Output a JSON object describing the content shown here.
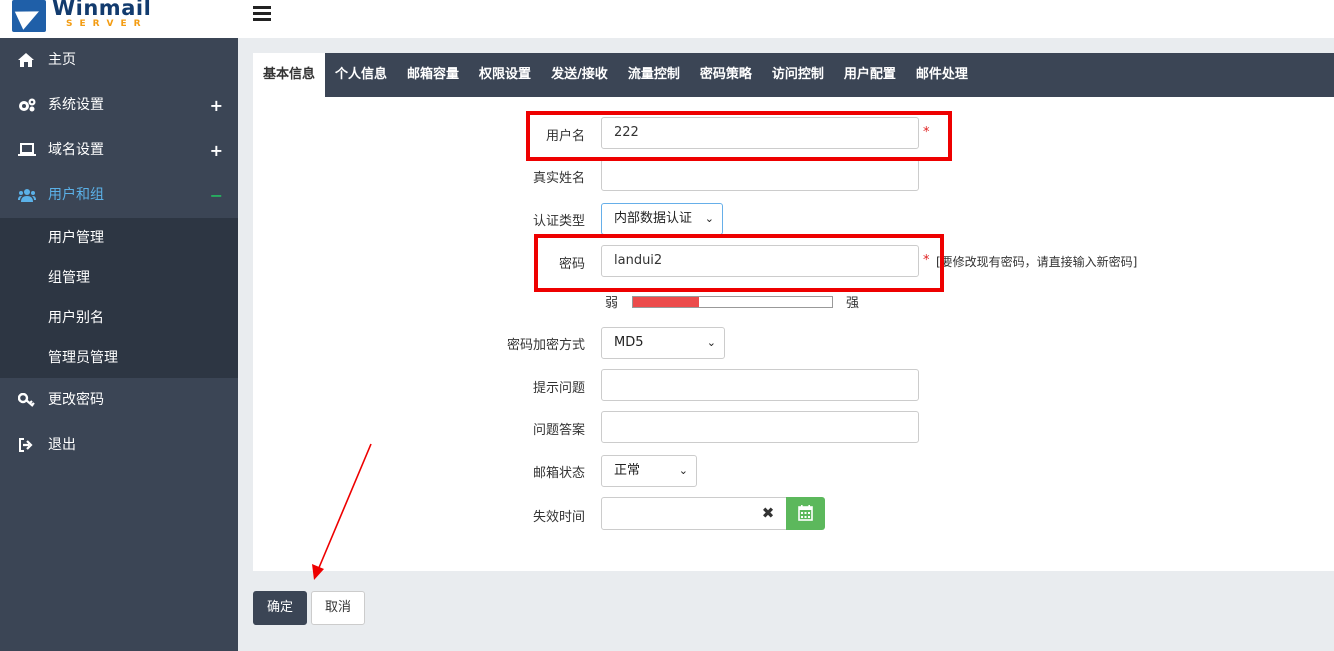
{
  "app": {
    "logo_name": "Winmail",
    "logo_sub": "SERVER"
  },
  "sidebar": {
    "items": [
      {
        "label": "主页",
        "icon": "home-icon",
        "toggle": ""
      },
      {
        "label": "系统设置",
        "icon": "gears-icon",
        "toggle": "+"
      },
      {
        "label": "域名设置",
        "icon": "laptop-icon",
        "toggle": "+"
      },
      {
        "label": "用户和组",
        "icon": "users-icon",
        "toggle": "−"
      },
      {
        "label": "更改密码",
        "icon": "key-icon",
        "toggle": ""
      },
      {
        "label": "退出",
        "icon": "sign-out-icon",
        "toggle": ""
      }
    ],
    "submenu": [
      "用户管理",
      "组管理",
      "用户别名",
      "管理员管理"
    ],
    "active_color": "#5bb1e8"
  },
  "tabs": [
    "基本信息",
    "个人信息",
    "邮箱容量",
    "权限设置",
    "发送/接收",
    "流量控制",
    "密码策略",
    "访问控制",
    "用户配置",
    "邮件处理"
  ],
  "form": {
    "username": {
      "label": "用户名",
      "value": "222",
      "required": "*"
    },
    "realname": {
      "label": "真实姓名",
      "value": ""
    },
    "auth_type": {
      "label": "认证类型",
      "value": "内部数据认证"
    },
    "password": {
      "label": "密码",
      "value": "landui2",
      "required": "*",
      "hint": "[要修改现有密码，请直接输入新密码]"
    },
    "strength": {
      "weak": "弱",
      "strong": "强",
      "level": 0.33
    },
    "encryption": {
      "label": "密码加密方式",
      "value": "MD5"
    },
    "question": {
      "label": "提示问题",
      "value": ""
    },
    "answer": {
      "label": "问题答案",
      "value": ""
    },
    "status": {
      "label": "邮箱状态",
      "value": "正常"
    },
    "expire": {
      "label": "失效时间",
      "value": ""
    }
  },
  "buttons": {
    "ok": "确定",
    "cancel": "取消"
  },
  "colors": {
    "highlight": "#ee0000",
    "sidebar_bg": "#3b4555",
    "calendar_btn": "#5cb85c"
  }
}
